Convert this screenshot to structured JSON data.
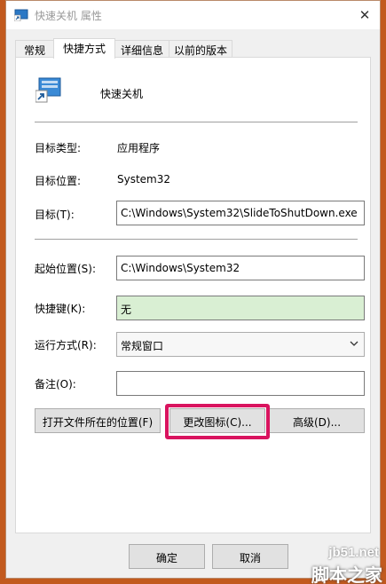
{
  "window": {
    "title": "快速关机 属性",
    "close_glyph": "✕"
  },
  "tabs": [
    {
      "label": "常规"
    },
    {
      "label": "快捷方式"
    },
    {
      "label": "详细信息"
    },
    {
      "label": "以前的版本"
    }
  ],
  "shortcut": {
    "name": "快速关机",
    "target_type_label": "目标类型:",
    "target_type_value": "应用程序",
    "target_location_label": "目标位置:",
    "target_location_value": "System32",
    "target_label": "目标(T):",
    "target_value": "C:\\Windows\\System32\\SlideToShutDown.exe",
    "start_in_label": "起始位置(S):",
    "start_in_value": "C:\\Windows\\System32",
    "hotkey_label": "快捷键(K):",
    "hotkey_value": "无",
    "run_label": "运行方式(R):",
    "run_value": "常规窗口",
    "comment_label": "备注(O):",
    "comment_value": ""
  },
  "buttons": {
    "open_location": "打开文件所在的位置(F)",
    "change_icon": "更改图标(C)...",
    "advanced": "高级(D)...",
    "ok": "确定",
    "cancel": "取消"
  },
  "watermark": {
    "url": "jb51.net",
    "text": "脚本之家"
  },
  "colors": {
    "highlight": "#d9145f",
    "hotkey_bg": "#d9efd3"
  }
}
